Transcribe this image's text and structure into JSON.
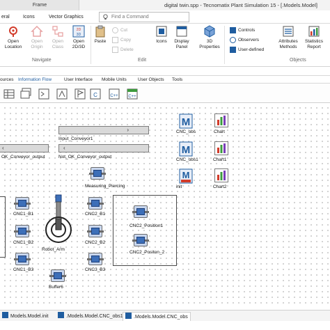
{
  "titlebar": {
    "frame_tab": "Frame",
    "title": "digital twin.spp - Tecnomatix Plant Simulation 15 - [.Models.Model]"
  },
  "tabs": [
    "eral",
    "Icons",
    "Vector Graphics"
  ],
  "search": {
    "placeholder": "Find a Command"
  },
  "ribbon": {
    "navigate": {
      "label": "Navigate",
      "open_location": "Open\nLocation",
      "open_origin": "Open\nOrigin",
      "open_class": "Open\nClass",
      "open_2d3d": "Open\n2D/3D"
    },
    "edit": {
      "label": "Edit",
      "paste": "Paste",
      "cut": "Cut",
      "copy": "Copy",
      "delete": "Delete",
      "icons": "Icons",
      "display_panel": "Display\nPanel",
      "properties_3d": "3D\nProperties"
    },
    "objects": {
      "label": "Objects",
      "controls": "Controls",
      "observers": "Observers",
      "user_defined": "User-defined",
      "attributes_methods": "Attributes\nMethods",
      "statistics_report": "Statistics\nReport"
    }
  },
  "library_tabs": [
    "ources",
    "Information Flow",
    "User Interface",
    "Mobile Units",
    "User Objects",
    "Tools"
  ],
  "library_icons": [
    "table-icon",
    "tables-icon",
    "method-icon",
    "generator-icon",
    "flag-icon",
    "method-c-icon",
    "method-cpp-icon",
    "html-cpp-icon"
  ],
  "canvas": {
    "objects": {
      "input_conveyor": "Input_Conveyor1",
      "not_ok_conveyor": "Not_OK_Conveyor_output",
      "ok_conveyor": "OK_Conveyor_output",
      "measuring": "Measuring_Piercing",
      "robot": "Robot_Arm",
      "buffer": "Buffer6",
      "cnc1_b1": "CNC1_B1",
      "cnc1_b2": "CNC1_B2",
      "cnc1_b3": "CNC1_B3",
      "cnc2_b1": "CNC2_B1",
      "cnc2_b2": "CNC2_B2",
      "cnc3_b3": "CNC3_B3",
      "cnc2_pos1": "CNC2_Position1",
      "cnc2_pos2": "CNC2_Positon_2",
      "cnc_obs": "CNC_obs",
      "cnc_obs1": "CNC_obs1",
      "init": "init",
      "chart": "Chart",
      "chart1": "Chart1",
      "chart2": "Chart2",
      "m_letter": "M"
    }
  },
  "bottom_tabs": [
    {
      "label": "Models.Model.init",
      "active": false
    },
    {
      "label": ".Models.Model.CNC_obs1",
      "active": false
    },
    {
      "label": ".Models.Model.CNC_obs",
      "active": true
    }
  ],
  "colors": {
    "accent": "#1f5da0",
    "station_blue": "#3d6fb8",
    "method_red": "#d23b2a"
  }
}
